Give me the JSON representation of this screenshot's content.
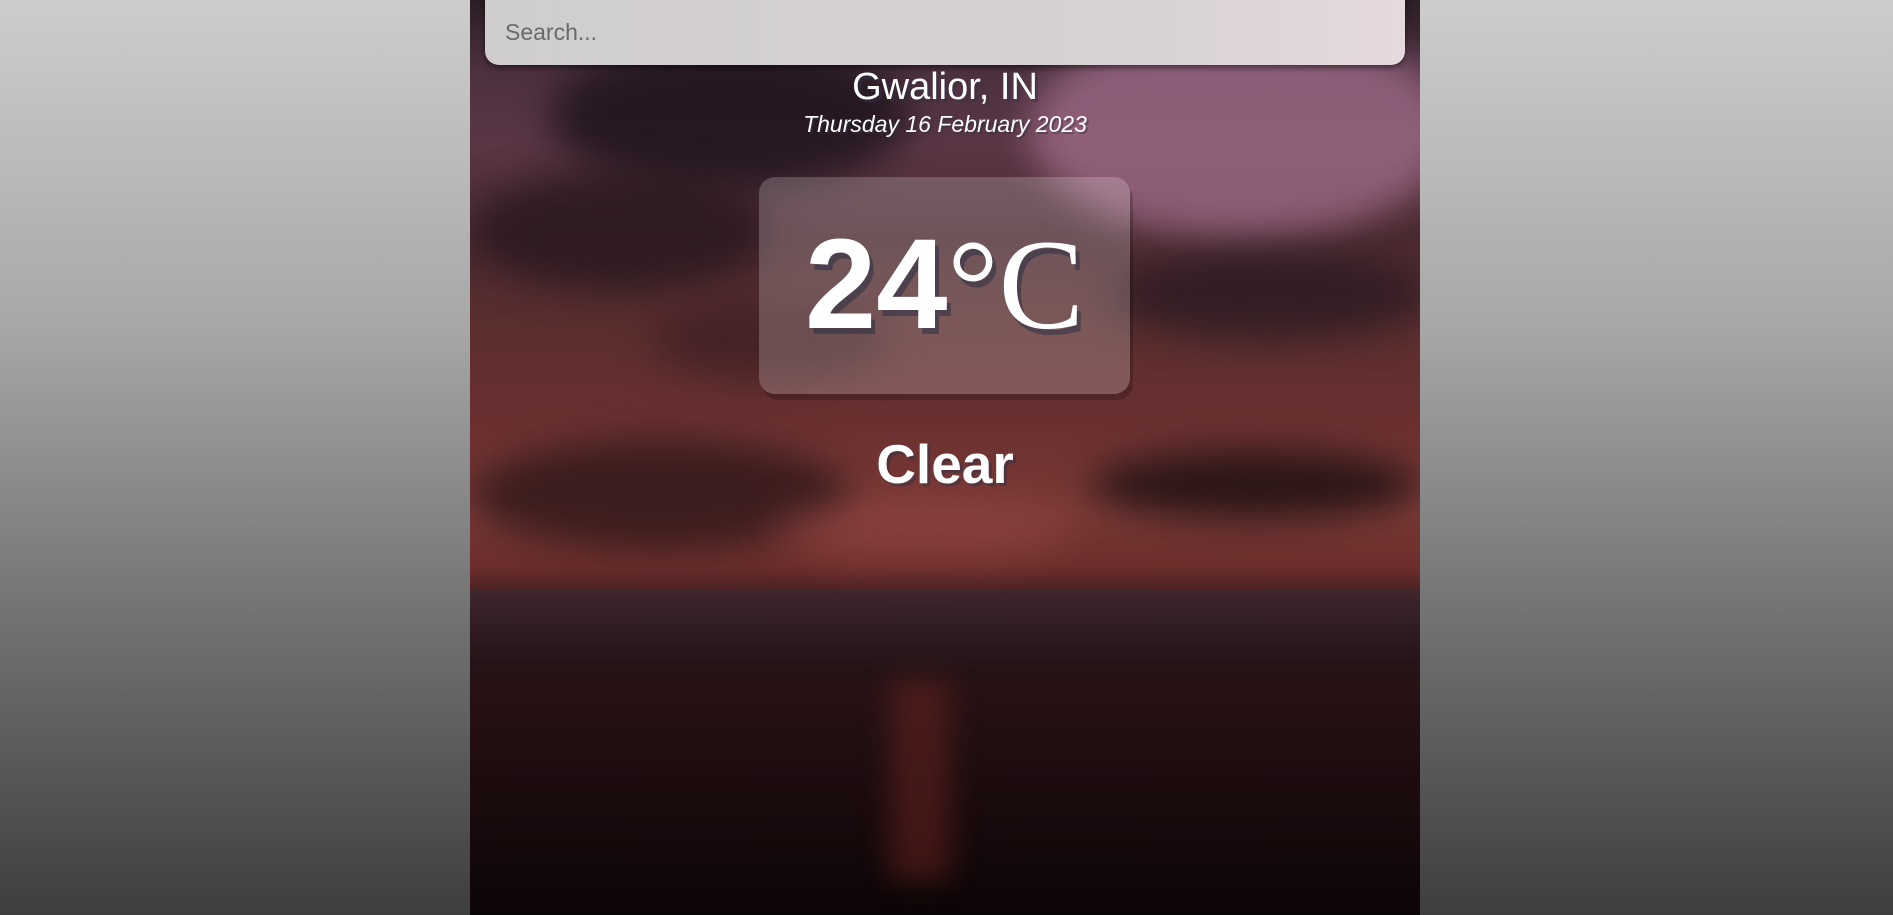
{
  "search": {
    "placeholder": "Search..."
  },
  "location": {
    "city": "Gwalior, IN",
    "date": "Thursday 16 February 2023"
  },
  "weather": {
    "temperature": "24",
    "unit": "°C",
    "condition": "Clear"
  }
}
